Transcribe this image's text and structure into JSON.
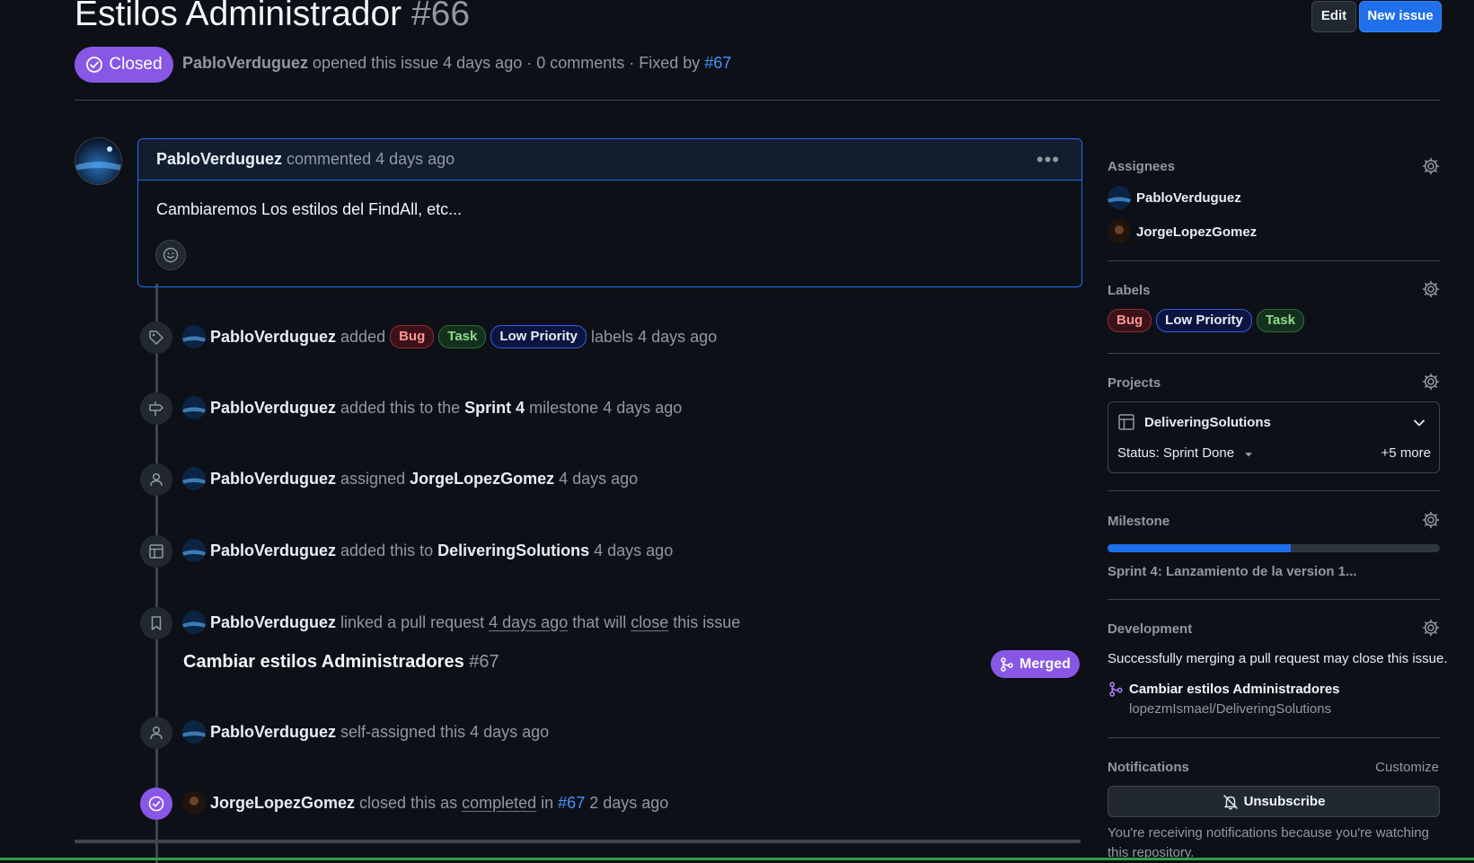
{
  "header": {
    "title": "Estilos Administrador",
    "number": "#66",
    "edit_label": "Edit",
    "new_issue_label": "New issue",
    "state_label": "Closed",
    "meta_author": "PabloVerduguez",
    "meta_text": "opened this issue 4 days ago · 0 comments · Fixed by",
    "meta_fix_link": "#67"
  },
  "comment": {
    "author": "PabloVerduguez",
    "when": "commented 4 days ago",
    "body": "Cambiaremos Los estilos del FindAll, etc..."
  },
  "events": {
    "labels": {
      "author": "PabloVerduguez",
      "verb": "added",
      "labels": [
        "Bug",
        "Task",
        "Low Priority"
      ],
      "tail": "labels 4 days ago"
    },
    "milestone": {
      "author": "PabloVerduguez",
      "pre": "added this to the",
      "target": "Sprint 4",
      "post": "milestone 4 days ago"
    },
    "assigned": {
      "author": "PabloVerduguez",
      "pre": "assigned",
      "target": "JorgeLopezGomez",
      "post": "4 days ago"
    },
    "project": {
      "author": "PabloVerduguez",
      "pre": "added this to",
      "target": "DeliveringSolutions",
      "post": "4 days ago"
    },
    "linked": {
      "author": "PabloVerduguez",
      "pre": "linked a pull request",
      "when": "4 days ago",
      "mid": "that will",
      "close": "close",
      "post": "this issue",
      "pr_title": "Cambiar estilos Administradores",
      "pr_number": "#67",
      "pr_state": "Merged"
    },
    "self_assigned": {
      "author": "PabloVerduguez",
      "post": "self-assigned this 4 days ago"
    },
    "closed": {
      "author": "JorgeLopezGomez",
      "pre": "closed this as",
      "completed": "completed",
      "in": "in",
      "link": "#67",
      "post": "2 days ago"
    }
  },
  "sidebar": {
    "assignees_title": "Assignees",
    "assignees": [
      "PabloVerduguez",
      "JorgeLopezGomez"
    ],
    "labels_title": "Labels",
    "labels": [
      "Bug",
      "Low Priority",
      "Task"
    ],
    "projects_title": "Projects",
    "project_name": "DeliveringSolutions",
    "project_status": "Status: Sprint Done",
    "project_more": "+5 more",
    "milestone_title": "Milestone",
    "milestone_progress": 0.55,
    "milestone_name": "Sprint 4: Lanzamiento de la version 1...",
    "development_title": "Development",
    "development_text": "Successfully merging a pull request may close this issue.",
    "dev_pr_title": "Cambiar estilos Administradores",
    "dev_pr_repo": "lopezmIsmael/DeliveringSolutions",
    "notifications_title": "Notifications",
    "customize_label": "Customize",
    "unsubscribe_label": "Unsubscribe",
    "notifications_text": "You're receiving notifications because you're watching this repository."
  },
  "colors": {
    "accent": "#1f6feb",
    "closed": "#8957e5",
    "bg": "#0d1117"
  }
}
